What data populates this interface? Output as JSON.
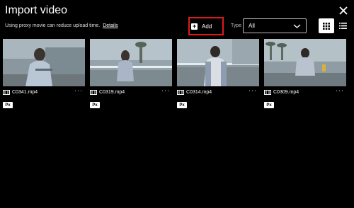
{
  "header": {
    "title": "Import video",
    "subtitle": "Using proxy movie can reduce upload time.",
    "details_link": "Details"
  },
  "toolbar": {
    "add_label": "Add",
    "type_label": "Type",
    "type_value": "All",
    "highlight_color": "#e0191e"
  },
  "videos": [
    {
      "filename": "C0341.mp4",
      "badge": "Px",
      "more": "···"
    },
    {
      "filename": "C0319.mp4",
      "badge": "Px",
      "more": "···"
    },
    {
      "filename": "C0314.mp4",
      "badge": "Px",
      "more": "···"
    },
    {
      "filename": "C0309.mp4",
      "badge": "Px",
      "more": "···"
    }
  ]
}
